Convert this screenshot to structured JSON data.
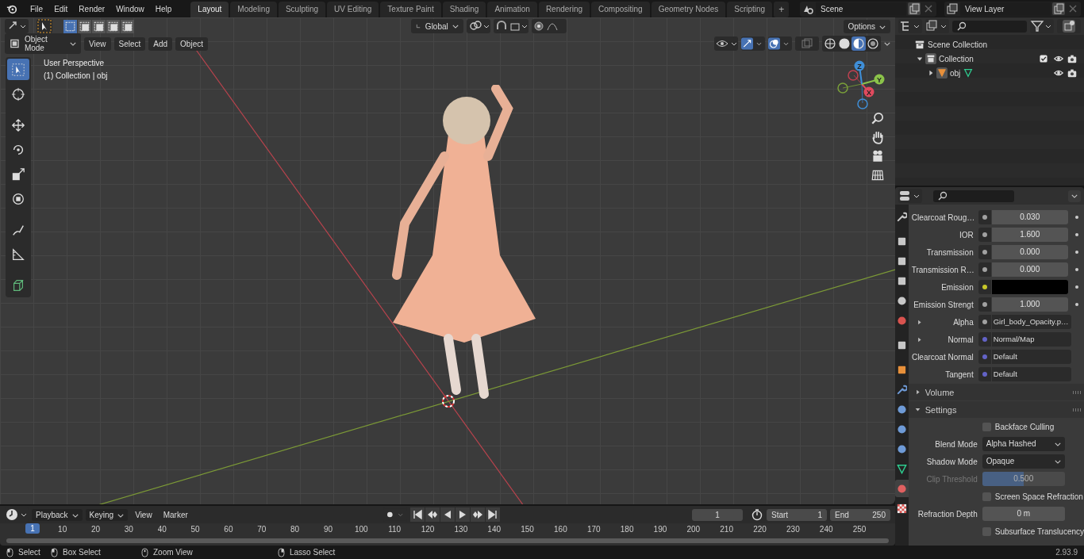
{
  "menu": [
    "File",
    "Edit",
    "Render",
    "Window",
    "Help"
  ],
  "workspaces": [
    {
      "label": "Layout",
      "selected": true
    },
    {
      "label": "Modeling",
      "selected": false
    },
    {
      "label": "Sculpting",
      "selected": false
    },
    {
      "label": "UV Editing",
      "selected": false
    },
    {
      "label": "Texture Paint",
      "selected": false
    },
    {
      "label": "Shading",
      "selected": false
    },
    {
      "label": "Animation",
      "selected": false
    },
    {
      "label": "Rendering",
      "selected": false
    },
    {
      "label": "Compositing",
      "selected": false
    },
    {
      "label": "Geometry Nodes",
      "selected": false
    },
    {
      "label": "Scripting",
      "selected": false
    }
  ],
  "add_workspace": "+",
  "scene": "Scene",
  "view_layer": "View Layer",
  "viewport": {
    "mode": "Object Mode",
    "menus": [
      "View",
      "Select",
      "Add",
      "Object"
    ],
    "orientation": "Global",
    "options": "Options",
    "overlay_text": [
      "User Perspective",
      "(1) Collection | obj"
    ],
    "gizmo_axes": [
      "X",
      "Y",
      "Z"
    ],
    "shading_modes": [
      {
        "selected": false
      },
      {
        "selected": false
      },
      {
        "selected": true
      },
      {
        "selected": false
      }
    ],
    "tools": [
      {
        "kind": "select",
        "selected": true
      },
      {
        "kind": "cursor",
        "selected": false
      },
      {
        "kind": "move",
        "selected": false
      },
      {
        "kind": "rotate",
        "selected": false
      },
      {
        "kind": "scale",
        "selected": false
      },
      {
        "kind": "transform",
        "selected": false
      },
      {
        "kind": "annotate",
        "selected": false
      },
      {
        "kind": "measure",
        "selected": false
      },
      {
        "kind": "add-cube",
        "selected": false
      }
    ]
  },
  "outliner": {
    "tree": [
      {
        "label": "Scene Collection",
        "kind": "scene",
        "children": [
          {
            "label": "Collection",
            "kind": "collection",
            "expanded": true,
            "checked": true,
            "children": [
              {
                "label": "obj",
                "kind": "object",
                "expanded": false
              }
            ]
          }
        ]
      }
    ]
  },
  "properties": {
    "tabs": [
      {
        "kind": "tool",
        "selected": false
      },
      {
        "kind": "render",
        "selected": false
      },
      {
        "kind": "output",
        "selected": false
      },
      {
        "kind": "view-layer",
        "selected": false
      },
      {
        "kind": "scene",
        "selected": false
      },
      {
        "kind": "world",
        "selected": false
      },
      {
        "kind": "collection",
        "selected": false
      },
      {
        "kind": "object",
        "selected": false
      },
      {
        "kind": "modifier",
        "selected": false
      },
      {
        "kind": "particles",
        "selected": false
      },
      {
        "kind": "physics",
        "selected": false
      },
      {
        "kind": "constraints",
        "selected": false
      },
      {
        "kind": "data",
        "selected": false
      },
      {
        "kind": "material",
        "selected": true
      },
      {
        "kind": "texture",
        "selected": false
      }
    ],
    "inputs": [
      {
        "label": "Clearcoat Roug…",
        "kind": "number",
        "color": "#a1a1a1",
        "value": "0.030"
      },
      {
        "label": "IOR",
        "kind": "number",
        "color": "#a1a1a1",
        "value": "1.600"
      },
      {
        "label": "Transmission",
        "kind": "number",
        "color": "#a1a1a1",
        "value": "0.000"
      },
      {
        "label": "Transmission R…",
        "kind": "number",
        "color": "#a1a1a1",
        "value": "0.000"
      },
      {
        "label": "Emission",
        "kind": "color",
        "color": "#c7c729"
      },
      {
        "label": "Emission Strengt",
        "kind": "number",
        "color": "#a1a1a1",
        "value": "1.000"
      },
      {
        "label": "Alpha",
        "kind": "link",
        "color": "#a1a1a1",
        "value": "Girl_body_Opacity.p…",
        "expanded": false
      },
      {
        "label": "Normal",
        "kind": "link",
        "color": "#6363c7",
        "value": "Normal/Map",
        "expanded": false
      },
      {
        "label": "Clearcoat Normal",
        "kind": "link",
        "color": "#6363c7",
        "value": "Default"
      },
      {
        "label": "Tangent",
        "kind": "link",
        "color": "#6363c7",
        "value": "Default"
      }
    ],
    "sections": [
      {
        "label": "Volume",
        "expanded": false
      },
      {
        "label": "Settings",
        "expanded": true
      }
    ],
    "settings": [
      {
        "kind": "checkbox",
        "label": "Backface Culling",
        "checked": false
      },
      {
        "kind": "dropdown",
        "label": "Blend Mode",
        "value": "Alpha Hashed"
      },
      {
        "kind": "dropdown",
        "label": "Shadow Mode",
        "value": "Opaque"
      },
      {
        "kind": "slider",
        "label": "Clip Threshold",
        "value": "0.500",
        "level": 0.5,
        "disabled": true
      },
      {
        "kind": "checkbox",
        "label": "Screen Space Refraction",
        "checked": false
      },
      {
        "kind": "number",
        "label": "Refraction Depth",
        "value": "0 m"
      },
      {
        "kind": "checkbox",
        "label": "Subsurface Translucency",
        "checked": false
      }
    ]
  },
  "timeline": {
    "menus": [
      "Playback",
      "Keying",
      "View",
      "Marker"
    ],
    "current_frame": "1",
    "start_label": "Start",
    "start": "1",
    "end_label": "End",
    "end": "250",
    "playhead": "1",
    "ticks": [
      "10",
      "20",
      "30",
      "40",
      "50",
      "60",
      "70",
      "80",
      "90",
      "100",
      "110",
      "120",
      "130",
      "140",
      "150",
      "160",
      "170",
      "180",
      "190",
      "200",
      "210",
      "220",
      "230",
      "240",
      "250"
    ]
  },
  "status_bar": {
    "hints": [
      "Select",
      "Box Select",
      "Zoom View",
      "Lasso Select"
    ],
    "version": "2.93.9"
  }
}
